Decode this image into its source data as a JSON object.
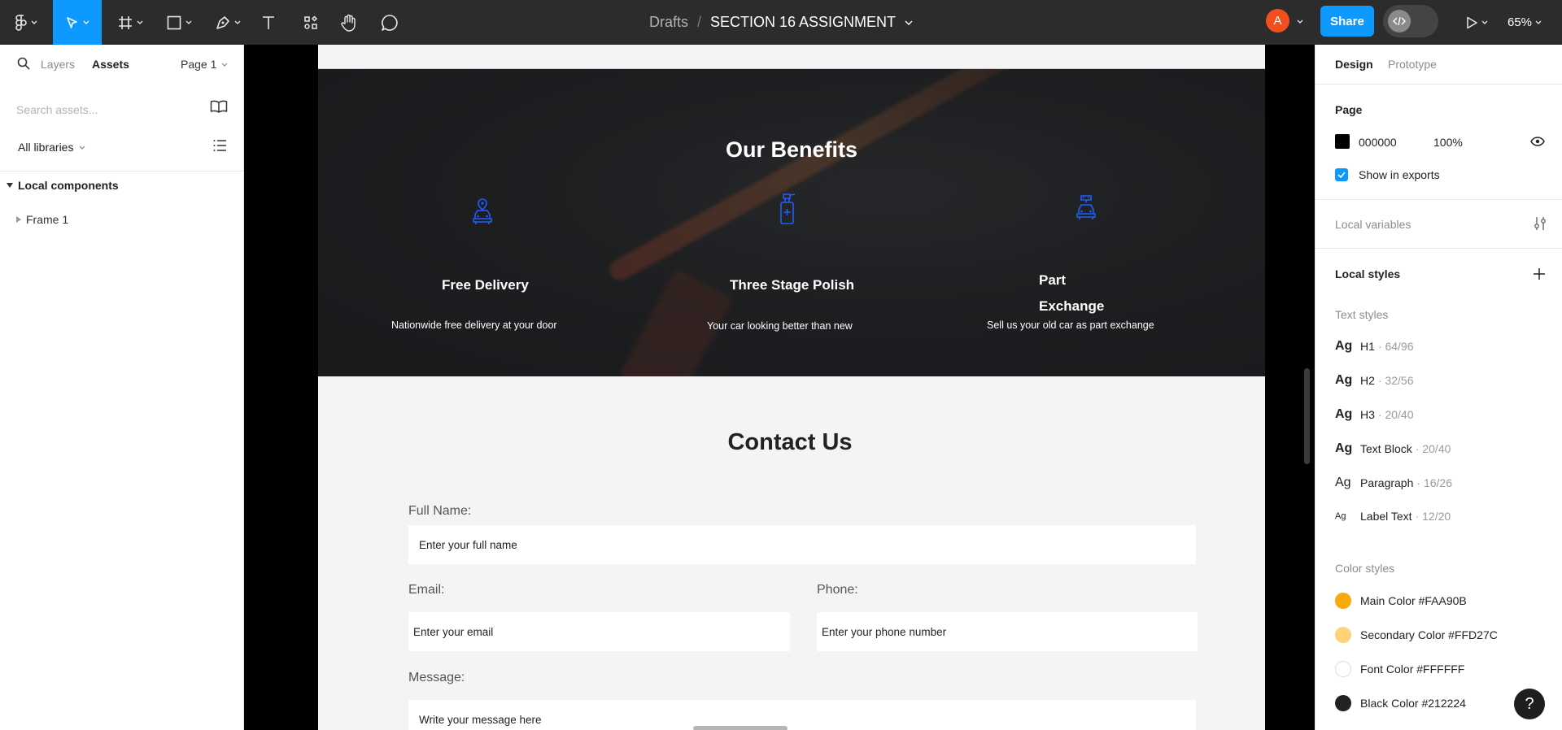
{
  "toolbar": {
    "breadcrumb_parent": "Drafts",
    "separator": "/",
    "file_name": "SECTION 16 ASSIGNMENT",
    "avatar_initial": "A",
    "share_label": "Share",
    "zoom_level": "65%",
    "icons": [
      "figma-menu-icon",
      "move-tool-icon",
      "frame-tool-icon",
      "shape-tool-icon",
      "pen-tool-icon",
      "text-tool-icon",
      "resources-icon",
      "hand-tool-icon",
      "comment-icon",
      "dev-mode-icon",
      "present-icon"
    ],
    "accent_color": "#0D99FF"
  },
  "left_panel": {
    "tabs": [
      "Layers",
      "Assets"
    ],
    "active_tab": "Assets",
    "page_selector": "Page 1",
    "search_placeholder": "Search assets...",
    "library_filter": "All libraries",
    "section_title": "Local components",
    "items": [
      "Frame 1"
    ]
  },
  "canvas": {
    "benefits": {
      "title": "Our Benefits",
      "items": [
        {
          "icon": "car-location-icon",
          "heading": "Free Delivery",
          "text": "Nationwide free delivery at your door"
        },
        {
          "icon": "spray-bottle-icon",
          "heading": "Three Stage Polish",
          "text": "Your car looking better than new"
        },
        {
          "icon": "car-wash-icon",
          "heading_line1": "Part",
          "heading_line2": "Exchange",
          "text": "Sell us your old car as part exchange"
        }
      ],
      "icon_color": "#1E5EFF"
    },
    "contact": {
      "title": "Contact Us",
      "full_name_label": "Full Name:",
      "full_name_placeholder": "Enter your full name",
      "email_label": "Email:",
      "email_placeholder": "Enter your email",
      "phone_label": "Phone:",
      "phone_placeholder": "Enter your phone number",
      "message_label": "Message:",
      "message_placeholder": "Write your message here"
    }
  },
  "right_panel": {
    "tabs": [
      "Design",
      "Prototype"
    ],
    "active_tab": "Design",
    "page_section": "Page",
    "page_color": "000000",
    "page_opacity": "100%",
    "show_in_exports": "Show in exports",
    "show_in_exports_checked": true,
    "local_variables": "Local variables",
    "local_styles": "Local styles",
    "text_styles_title": "Text styles",
    "text_styles": [
      {
        "preview": "Ag",
        "name": "H1",
        "meta": "· 64/96"
      },
      {
        "preview": "Ag",
        "name": "H2",
        "meta": "· 32/56"
      },
      {
        "preview": "Ag",
        "name": "H3",
        "meta": "· 20/40"
      },
      {
        "preview": "Ag",
        "name": "Text Block",
        "meta": "· 20/40"
      },
      {
        "preview": "Ag",
        "name": "Paragraph",
        "meta": "· 16/26"
      },
      {
        "preview": "Ag",
        "name": "Label Text",
        "meta": "· 12/20"
      }
    ],
    "color_styles_title": "Color styles",
    "color_styles": [
      {
        "label": "Main Color #FAA90B",
        "color": "#FAA90B"
      },
      {
        "label": "Secondary Color #FFD27C",
        "color": "#FFD27C"
      },
      {
        "label": "Font Color #FFFFFF",
        "color": "#FFFFFF"
      },
      {
        "label": "Black Color #212224",
        "color": "#212224"
      }
    ],
    "help_label": "?"
  }
}
